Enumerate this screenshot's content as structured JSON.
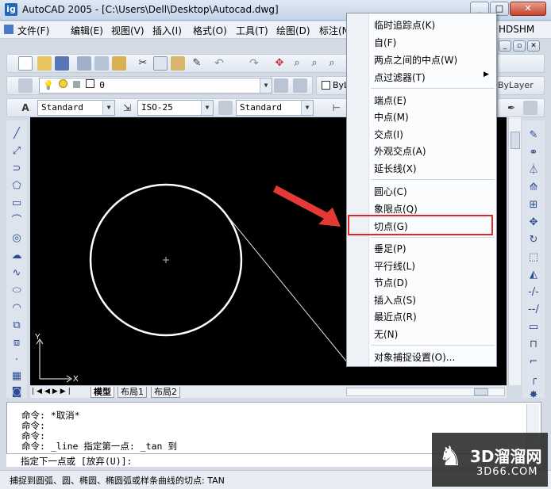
{
  "window": {
    "title": "AutoCAD 2005 - [C:\\Users\\Dell\\Desktop\\Autocad.dwg]",
    "app_icon_label": "ig",
    "min_label": "_",
    "max_label": "□",
    "close_label": "✕"
  },
  "menubar": {
    "items": [
      "文件(F)",
      "编辑(E)",
      "视图(V)",
      "插入(I)",
      "格式(O)",
      "工具(T)",
      "绘图(D)",
      "标注(N"
    ],
    "right_label": "HDSHM"
  },
  "layer_bar": {
    "layer_value": "0",
    "bylayer_left": "ByL",
    "bylayer_right": "ByLayer"
  },
  "styles_bar": {
    "text_style": "Standard",
    "dim_style": "ISO-25",
    "table_style": "Standard"
  },
  "canvas": {
    "ucs_x": "X",
    "ucs_y": "Y"
  },
  "tabs": [
    "模型",
    "布局1",
    "布局2"
  ],
  "command": {
    "lines": [
      "命令: *取消*",
      "命令:",
      "命令:",
      "命令: _line 指定第一点: _tan 到"
    ],
    "prompt": "指定下一点或 [放弃(U)]:"
  },
  "status": {
    "text": "捕捉到圆弧、圆、椭圆、椭圆弧或样条曲线的切点:  TAN"
  },
  "context_menu": {
    "groups": [
      [
        "临时追踪点(K)",
        "自(F)",
        "两点之间的中点(W)",
        "点过滤器(T)"
      ],
      [
        "端点(E)",
        "中点(M)",
        "交点(I)",
        "外观交点(A)",
        "延长线(X)"
      ],
      [
        "圆心(C)",
        "象限点(Q)",
        "切点(G)"
      ],
      [
        "垂足(P)",
        "平行线(L)",
        "节点(D)",
        "插入点(S)",
        "最近点(R)",
        "无(N)"
      ],
      [
        "对象捕捉设置(O)..."
      ]
    ],
    "highlighted_item": "切点(G)"
  },
  "watermark": {
    "text": "3D溜溜网",
    "sub": "3D66.COM"
  },
  "colors": {
    "highlight": "#e02828",
    "arrow": "#e53935",
    "canvas": "#000000"
  }
}
